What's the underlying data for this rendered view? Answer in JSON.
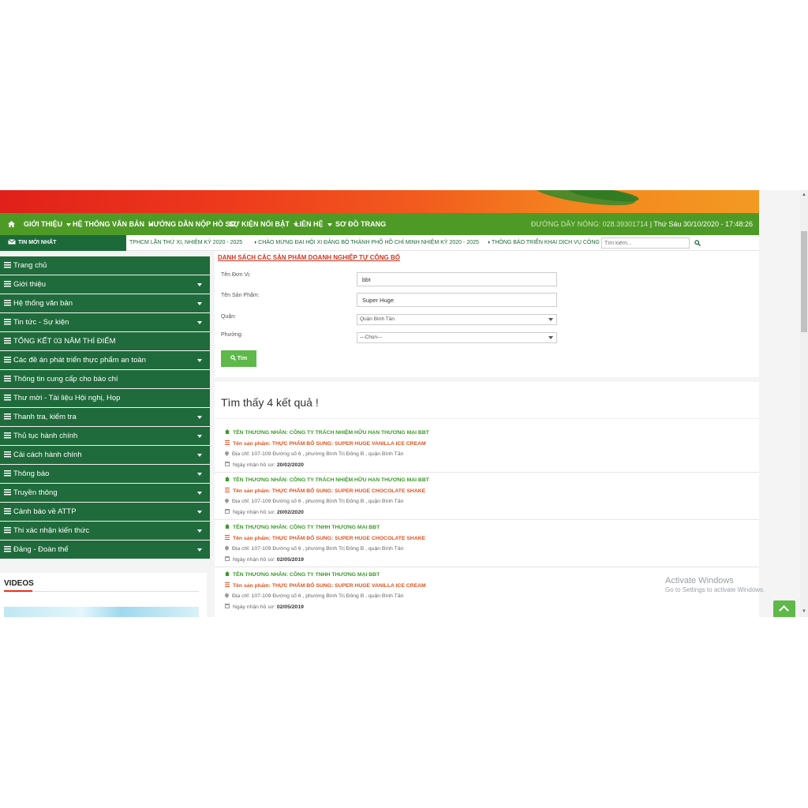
{
  "nav": {
    "items": [
      {
        "label": "GIỚI THIỆU",
        "dropdown": true
      },
      {
        "label": "HỆ THỐNG VĂN BẢN",
        "dropdown": true
      },
      {
        "label": "HƯỚNG DẪN NỘP HỒ SƠ",
        "dropdown": false
      },
      {
        "label": "SỰ KIỆN NỔI BẬT",
        "dropdown": true
      },
      {
        "label": "LIÊN HỆ",
        "dropdown": true
      },
      {
        "label": "SƠ ĐỒ TRANG",
        "dropdown": false
      }
    ],
    "hotline": "ĐƯỜNG DÂY NÓNG: 028.39301714",
    "datetime": "Thứ Sáu 30/10/2020 - 17:48:26"
  },
  "news": {
    "label": "TIN MỚI NHẤT",
    "items": [
      "TPHCM LẦN THỨ XI, NHIỆM KỲ 2020 - 2025",
      "CHÀO MỪNG ĐẠI HỘI XI ĐẢNG BỘ THÀNH PHỐ HỒ CHÍ MINH NHIỆM KỲ 2020 - 2025",
      "THÔNG BÁO TRIỂN KHAI DỊCH VỤ CÔNG"
    ],
    "search_placeholder": "Tìm kiếm..."
  },
  "sidebar": {
    "items": [
      {
        "label": "Trang chủ",
        "dropdown": false
      },
      {
        "label": "Giới thiệu",
        "dropdown": true
      },
      {
        "label": "Hệ thống văn bản",
        "dropdown": true
      },
      {
        "label": "Tin tức - Sự kiện",
        "dropdown": true
      },
      {
        "label": "TỔNG KẾT 03 NĂM THÍ ĐIỂM",
        "dropdown": false
      },
      {
        "label": "Các đề án phát triển thực phẩm an toàn",
        "dropdown": true
      },
      {
        "label": "Thông tin cung cấp cho báo chí",
        "dropdown": false
      },
      {
        "label": "Thư mời - Tài liệu Hội nghị, Họp",
        "dropdown": false
      },
      {
        "label": "Thanh tra, kiểm tra",
        "dropdown": true
      },
      {
        "label": "Thủ tục hành chính",
        "dropdown": true
      },
      {
        "label": "Cải cách hành chính",
        "dropdown": true
      },
      {
        "label": "Thông báo",
        "dropdown": true
      },
      {
        "label": "Truyền thông",
        "dropdown": true
      },
      {
        "label": "Cảnh báo về ATTP",
        "dropdown": true
      },
      {
        "label": "Thi xác nhận kiến thức",
        "dropdown": true
      },
      {
        "label": "Đảng - Đoàn thể",
        "dropdown": true
      }
    ],
    "videos_title": "VIDEOS"
  },
  "form": {
    "title": "DANH SÁCH CÁC SẢN PHẨM DOANH NGHIỆP TỰ CÔNG BỐ",
    "unit_label": "Tên Đơn Vị:",
    "unit_value": "bbt",
    "product_label": "Tên Sản Phẩm:",
    "product_value": "Super Huge",
    "district_label": "Quận:",
    "district_value": "Quận Bình Tân",
    "ward_label": "Phường:",
    "ward_value": "---Chọn---",
    "search_button": "Tìm"
  },
  "results": {
    "count_text": "Tìm thấy 4 kết quả !",
    "date_prefix": "Ngày nhận hồ sơ:",
    "items": [
      {
        "merchant": "TÊN THƯƠNG NHÂN: CÔNG TY TRÁCH NHIỆM HỮU HẠN THƯƠNG MẠI BBT",
        "product": "Tên sản phẩm: THỰC PHẨM BỔ SUNG: SUPER HUGE VANILLA ICE CREAM",
        "address": "Địa chỉ: 107-109 Đường số 6 , phường Bình Trị Đông B , quận Bình Tân",
        "date": "20/02/2020"
      },
      {
        "merchant": "TÊN THƯƠNG NHÂN: CÔNG TY TRÁCH NHIỆM HỮU HẠN THƯƠNG MẠI BBT",
        "product": "Tên sản phẩm: THỰC PHẨM BỔ SUNG: SUPER HUGE CHOCOLATE SHAKE",
        "address": "Địa chỉ: 107-109 Đường số 6 , phường Bình Trị Đông B , quận Bình Tân",
        "date": "20/02/2020"
      },
      {
        "merchant": "TÊN THƯƠNG NHÂN: CÔNG TY TNHH THƯƠNG MẠI BBT",
        "product": "Tên sản phẩm: THỰC PHẨM BỔ SUNG: SUPER HUGE CHOCOLATE SHAKE",
        "address": "Địa chỉ: 107-109 Đường số 6 , phường Bình Trị Đông B , quận Bình Tân",
        "date": "02/05/2019"
      },
      {
        "merchant": "TÊN THƯƠNG NHÂN: CÔNG TY TNHH THƯƠNG MẠI BBT",
        "product": "Tên sản phẩm: THỰC PHẨM BỔ SUNG: SUPER HUGE VANILLA ICE CREAM",
        "address": "Địa chỉ: 107-109 Đường số 6 , phường Bình Trị Đông B , quận Bình Tân",
        "date": "02/05/2019"
      }
    ]
  },
  "overlay": {
    "activate_line1": "Activate Windows",
    "activate_line2": "Go to Settings to activate Windows."
  },
  "colors": {
    "nav_green": "#4e9a26",
    "sidebar_green": "#1f6b3b",
    "title_red": "#d2341f",
    "merchant_green": "#3c9a2a",
    "product_orange": "#e2521f",
    "button_green": "#5fb84a"
  }
}
